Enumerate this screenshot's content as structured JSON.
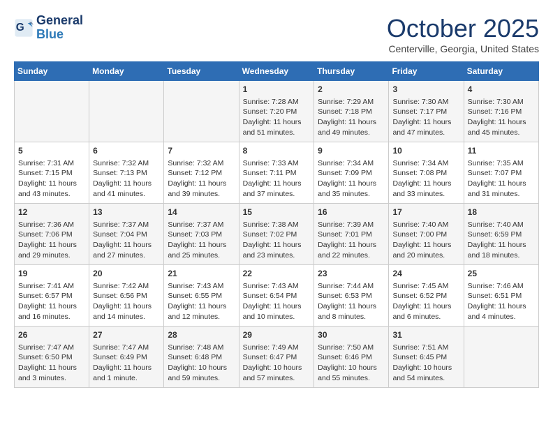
{
  "header": {
    "logo_line1": "General",
    "logo_line2": "Blue",
    "month": "October 2025",
    "location": "Centerville, Georgia, United States"
  },
  "days_of_week": [
    "Sunday",
    "Monday",
    "Tuesday",
    "Wednesday",
    "Thursday",
    "Friday",
    "Saturday"
  ],
  "weeks": [
    [
      {
        "day": "",
        "content": ""
      },
      {
        "day": "",
        "content": ""
      },
      {
        "day": "",
        "content": ""
      },
      {
        "day": "1",
        "content": "Sunrise: 7:28 AM\nSunset: 7:20 PM\nDaylight: 11 hours\nand 51 minutes."
      },
      {
        "day": "2",
        "content": "Sunrise: 7:29 AM\nSunset: 7:18 PM\nDaylight: 11 hours\nand 49 minutes."
      },
      {
        "day": "3",
        "content": "Sunrise: 7:30 AM\nSunset: 7:17 PM\nDaylight: 11 hours\nand 47 minutes."
      },
      {
        "day": "4",
        "content": "Sunrise: 7:30 AM\nSunset: 7:16 PM\nDaylight: 11 hours\nand 45 minutes."
      }
    ],
    [
      {
        "day": "5",
        "content": "Sunrise: 7:31 AM\nSunset: 7:15 PM\nDaylight: 11 hours\nand 43 minutes."
      },
      {
        "day": "6",
        "content": "Sunrise: 7:32 AM\nSunset: 7:13 PM\nDaylight: 11 hours\nand 41 minutes."
      },
      {
        "day": "7",
        "content": "Sunrise: 7:32 AM\nSunset: 7:12 PM\nDaylight: 11 hours\nand 39 minutes."
      },
      {
        "day": "8",
        "content": "Sunrise: 7:33 AM\nSunset: 7:11 PM\nDaylight: 11 hours\nand 37 minutes."
      },
      {
        "day": "9",
        "content": "Sunrise: 7:34 AM\nSunset: 7:09 PM\nDaylight: 11 hours\nand 35 minutes."
      },
      {
        "day": "10",
        "content": "Sunrise: 7:34 AM\nSunset: 7:08 PM\nDaylight: 11 hours\nand 33 minutes."
      },
      {
        "day": "11",
        "content": "Sunrise: 7:35 AM\nSunset: 7:07 PM\nDaylight: 11 hours\nand 31 minutes."
      }
    ],
    [
      {
        "day": "12",
        "content": "Sunrise: 7:36 AM\nSunset: 7:06 PM\nDaylight: 11 hours\nand 29 minutes."
      },
      {
        "day": "13",
        "content": "Sunrise: 7:37 AM\nSunset: 7:04 PM\nDaylight: 11 hours\nand 27 minutes."
      },
      {
        "day": "14",
        "content": "Sunrise: 7:37 AM\nSunset: 7:03 PM\nDaylight: 11 hours\nand 25 minutes."
      },
      {
        "day": "15",
        "content": "Sunrise: 7:38 AM\nSunset: 7:02 PM\nDaylight: 11 hours\nand 23 minutes."
      },
      {
        "day": "16",
        "content": "Sunrise: 7:39 AM\nSunset: 7:01 PM\nDaylight: 11 hours\nand 22 minutes."
      },
      {
        "day": "17",
        "content": "Sunrise: 7:40 AM\nSunset: 7:00 PM\nDaylight: 11 hours\nand 20 minutes."
      },
      {
        "day": "18",
        "content": "Sunrise: 7:40 AM\nSunset: 6:59 PM\nDaylight: 11 hours\nand 18 minutes."
      }
    ],
    [
      {
        "day": "19",
        "content": "Sunrise: 7:41 AM\nSunset: 6:57 PM\nDaylight: 11 hours\nand 16 minutes."
      },
      {
        "day": "20",
        "content": "Sunrise: 7:42 AM\nSunset: 6:56 PM\nDaylight: 11 hours\nand 14 minutes."
      },
      {
        "day": "21",
        "content": "Sunrise: 7:43 AM\nSunset: 6:55 PM\nDaylight: 11 hours\nand 12 minutes."
      },
      {
        "day": "22",
        "content": "Sunrise: 7:43 AM\nSunset: 6:54 PM\nDaylight: 11 hours\nand 10 minutes."
      },
      {
        "day": "23",
        "content": "Sunrise: 7:44 AM\nSunset: 6:53 PM\nDaylight: 11 hours\nand 8 minutes."
      },
      {
        "day": "24",
        "content": "Sunrise: 7:45 AM\nSunset: 6:52 PM\nDaylight: 11 hours\nand 6 minutes."
      },
      {
        "day": "25",
        "content": "Sunrise: 7:46 AM\nSunset: 6:51 PM\nDaylight: 11 hours\nand 4 minutes."
      }
    ],
    [
      {
        "day": "26",
        "content": "Sunrise: 7:47 AM\nSunset: 6:50 PM\nDaylight: 11 hours\nand 3 minutes."
      },
      {
        "day": "27",
        "content": "Sunrise: 7:47 AM\nSunset: 6:49 PM\nDaylight: 11 hours\nand 1 minute."
      },
      {
        "day": "28",
        "content": "Sunrise: 7:48 AM\nSunset: 6:48 PM\nDaylight: 10 hours\nand 59 minutes."
      },
      {
        "day": "29",
        "content": "Sunrise: 7:49 AM\nSunset: 6:47 PM\nDaylight: 10 hours\nand 57 minutes."
      },
      {
        "day": "30",
        "content": "Sunrise: 7:50 AM\nSunset: 6:46 PM\nDaylight: 10 hours\nand 55 minutes."
      },
      {
        "day": "31",
        "content": "Sunrise: 7:51 AM\nSunset: 6:45 PM\nDaylight: 10 hours\nand 54 minutes."
      },
      {
        "day": "",
        "content": ""
      }
    ]
  ]
}
